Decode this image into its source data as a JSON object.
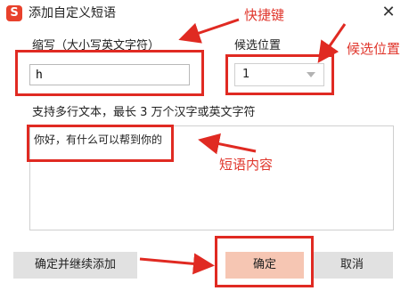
{
  "window": {
    "title": "添加自定义短语",
    "logo_letter": "S",
    "close_glyph": "✕"
  },
  "form": {
    "abbrev_label": "缩写（大小写英文字符）",
    "abbrev_value": "h",
    "position_label": "候选位置",
    "position_value": "1",
    "content_label": "支持多行文本，最长 3 万个汉字或英文字符",
    "content_value": "你好，有什么可以帮到你的"
  },
  "buttons": {
    "add_continue": "确定并继续添加",
    "ok": "确定",
    "cancel": "取消"
  },
  "annotations": {
    "shortcut_key": "快捷键",
    "candidate_position": "候选位置",
    "phrase_content": "短语内容",
    "color": "#e02a22"
  }
}
